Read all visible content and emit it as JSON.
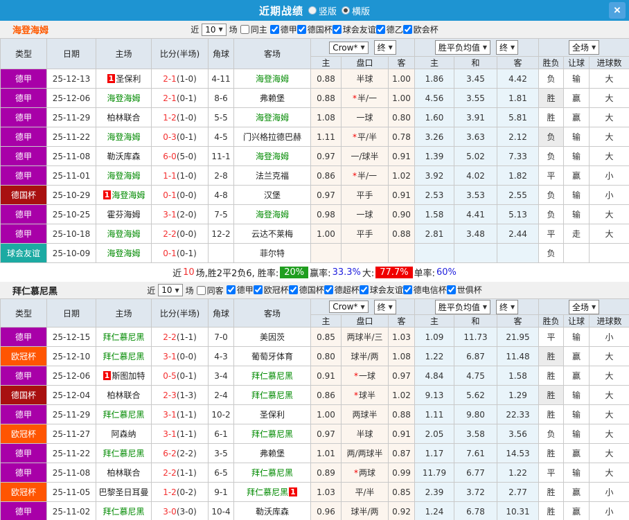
{
  "titlebar": {
    "title": "近期战绩",
    "vertical": "竖版",
    "horizontal": "横版",
    "selected": "横版",
    "close": "×"
  },
  "table_headers": {
    "type": "类型",
    "date": "日期",
    "home": "主场",
    "score": "比分(半场)",
    "corner": "角球",
    "away": "客场",
    "dd_company": "Crow*",
    "dd_final1": "终",
    "dd_avg": "胜平负均值",
    "dd_final2": "终",
    "dd_full": "全场",
    "sub_home": "主",
    "sub_handicap": "盘口",
    "sub_away": "客",
    "sub_avg_home": "主",
    "sub_avg_draw": "和",
    "sub_avg_away": "客",
    "sub_wdl": "胜负",
    "sub_let": "让球",
    "sub_goals": "进球数"
  },
  "type_colors": {
    "德甲": "#a800a8",
    "德国杯": "#a81010",
    "球会友谊": "#1caaa2",
    "欧冠杯": "#ff5502"
  },
  "result_colors": {
    "胜": "red",
    "负": "green",
    "平": "blue",
    "赢": "red",
    "输": "green",
    "走": "blue",
    "大": "red",
    "小": "green"
  },
  "sections": [
    {
      "team": "海登海姆",
      "team_color": "#ff5a00",
      "filter": {
        "prefix": "近",
        "count": "10",
        "suffix": "场",
        "same_label": "同主",
        "same_checked": false,
        "leagues": [
          "德甲",
          "德国杯",
          "球会友谊",
          "德乙",
          "欧会杯"
        ]
      },
      "rows": [
        {
          "type": "德甲",
          "date": "25-12-13",
          "home": "圣保利",
          "home_self": false,
          "home_badge": "1",
          "away": "海登海姆",
          "away_self": true,
          "away_badge": null,
          "score": "2-1",
          "half": "(1-0)",
          "corner": "4-11",
          "crown": [
            "0.88",
            "半球",
            "1.00"
          ],
          "star": false,
          "avg": [
            "1.86",
            "3.45",
            "4.42"
          ],
          "res": [
            "负",
            "输",
            "大"
          ],
          "res_gray": false
        },
        {
          "type": "德甲",
          "date": "25-12-06",
          "home": "海登海姆",
          "home_self": true,
          "home_badge": null,
          "away": "弗赖堡",
          "away_self": false,
          "away_badge": null,
          "score": "2-1",
          "half": "(0-1)",
          "corner": "8-6",
          "crown": [
            "0.88",
            "半/一",
            "1.00"
          ],
          "star": true,
          "avg": [
            "4.56",
            "3.55",
            "1.81"
          ],
          "res": [
            "胜",
            "赢",
            "大"
          ],
          "res_gray": true
        },
        {
          "type": "德甲",
          "date": "25-11-29",
          "home": "柏林联合",
          "home_self": false,
          "home_badge": null,
          "away": "海登海姆",
          "away_self": true,
          "away_badge": null,
          "score": "1-2",
          "half": "(1-0)",
          "corner": "5-5",
          "crown": [
            "1.08",
            "一球",
            "0.80"
          ],
          "star": false,
          "avg": [
            "1.60",
            "3.91",
            "5.81"
          ],
          "res": [
            "胜",
            "赢",
            "大"
          ],
          "res_gray": false
        },
        {
          "type": "德甲",
          "date": "25-11-22",
          "home": "海登海姆",
          "home_self": true,
          "home_badge": null,
          "away": "门兴格拉德巴赫",
          "away_self": false,
          "away_badge": null,
          "score": "0-3",
          "half": "(0-1)",
          "corner": "4-5",
          "crown": [
            "1.11",
            "平/半",
            "0.78"
          ],
          "star": true,
          "avg": [
            "3.26",
            "3.63",
            "2.12"
          ],
          "res": [
            "负",
            "输",
            "大"
          ],
          "res_gray": true
        },
        {
          "type": "德甲",
          "date": "25-11-08",
          "home": "勒沃库森",
          "home_self": false,
          "home_badge": null,
          "away": "海登海姆",
          "away_self": true,
          "away_badge": null,
          "score": "6-0",
          "half": "(5-0)",
          "corner": "11-1",
          "crown": [
            "0.97",
            "一/球半",
            "0.91"
          ],
          "star": false,
          "avg": [
            "1.39",
            "5.02",
            "7.33"
          ],
          "res": [
            "负",
            "输",
            "大"
          ],
          "res_gray": false
        },
        {
          "type": "德甲",
          "date": "25-11-01",
          "home": "海登海姆",
          "home_self": true,
          "home_badge": null,
          "away": "法兰克福",
          "away_self": false,
          "away_badge": null,
          "score": "1-1",
          "half": "(1-0)",
          "corner": "2-8",
          "crown": [
            "0.86",
            "半/一",
            "1.02"
          ],
          "star": true,
          "avg": [
            "3.92",
            "4.02",
            "1.82"
          ],
          "res": [
            "平",
            "赢",
            "小"
          ],
          "res_gray": false
        },
        {
          "type": "德国杯",
          "date": "25-10-29",
          "home": "海登海姆",
          "home_self": true,
          "home_badge": "1",
          "away": "汉堡",
          "away_self": false,
          "away_badge": null,
          "score": "0-1",
          "half": "(0-0)",
          "corner": "4-8",
          "crown": [
            "0.97",
            "平手",
            "0.91"
          ],
          "star": false,
          "avg": [
            "2.53",
            "3.53",
            "2.55"
          ],
          "res": [
            "负",
            "输",
            "小"
          ],
          "res_gray": false
        },
        {
          "type": "德甲",
          "date": "25-10-25",
          "home": "霍芬海姆",
          "home_self": false,
          "home_badge": null,
          "away": "海登海姆",
          "away_self": true,
          "away_badge": null,
          "score": "3-1",
          "half": "(2-0)",
          "corner": "7-5",
          "crown": [
            "0.98",
            "一球",
            "0.90"
          ],
          "star": false,
          "avg": [
            "1.58",
            "4.41",
            "5.13"
          ],
          "res": [
            "负",
            "输",
            "大"
          ],
          "res_gray": false
        },
        {
          "type": "德甲",
          "date": "25-10-18",
          "home": "海登海姆",
          "home_self": true,
          "home_badge": null,
          "away": "云达不莱梅",
          "away_self": false,
          "away_badge": null,
          "score": "2-2",
          "half": "(0-0)",
          "corner": "12-2",
          "crown": [
            "1.00",
            "平手",
            "0.88"
          ],
          "star": false,
          "avg": [
            "2.81",
            "3.48",
            "2.44"
          ],
          "res": [
            "平",
            "走",
            "大"
          ],
          "res_gray": false
        },
        {
          "type": "球会友谊",
          "date": "25-10-09",
          "home": "海登海姆",
          "home_self": true,
          "home_badge": null,
          "away": "菲尔特",
          "away_self": false,
          "away_badge": null,
          "score": "0-1",
          "half": "(0-1)",
          "corner": "",
          "crown": [
            "",
            "",
            ""
          ],
          "star": false,
          "avg": [
            "",
            "",
            ""
          ],
          "res": [
            "负",
            "",
            ""
          ],
          "res_gray": false
        }
      ],
      "summary": [
        {
          "text": "近",
          "style": "plain"
        },
        {
          "text": "10",
          "style": "red"
        },
        {
          "text": "场,胜2平2负6, 胜率:",
          "style": "plain"
        },
        {
          "text": "20%",
          "style": "green-badge"
        },
        {
          "text": "赢率:",
          "style": "plain"
        },
        {
          "text": "33.3%",
          "style": "blue"
        },
        {
          "text": "大:",
          "style": "plain"
        },
        {
          "text": "77.7%",
          "style": "red-badge"
        },
        {
          "text": "单率:",
          "style": "plain"
        },
        {
          "text": "60%",
          "style": "blue"
        }
      ]
    },
    {
      "team": "拜仁慕尼黑",
      "team_color": "#222222",
      "filter": {
        "prefix": "近",
        "count": "10",
        "suffix": "场",
        "same_label": "同客",
        "same_checked": false,
        "leagues": [
          "德甲",
          "欧冠杯",
          "德国杯",
          "德超杯",
          "球会友谊",
          "德电信杯",
          "世俱杯"
        ]
      },
      "rows": [
        {
          "type": "德甲",
          "date": "25-12-15",
          "home": "拜仁慕尼黑",
          "home_self": true,
          "home_badge": null,
          "away": "美因茨",
          "away_self": false,
          "away_badge": null,
          "score": "2-2",
          "half": "(1-1)",
          "corner": "7-0",
          "crown": [
            "0.85",
            "两球半/三",
            "1.03"
          ],
          "star": false,
          "avg": [
            "1.09",
            "11.73",
            "21.95"
          ],
          "res": [
            "平",
            "输",
            "小"
          ],
          "res_gray": false
        },
        {
          "type": "欧冠杯",
          "date": "25-12-10",
          "home": "拜仁慕尼黑",
          "home_self": true,
          "home_badge": null,
          "away": "葡萄牙体育",
          "away_self": false,
          "away_badge": null,
          "score": "3-1",
          "half": "(0-0)",
          "corner": "4-3",
          "crown": [
            "0.80",
            "球半/两",
            "1.08"
          ],
          "star": false,
          "avg": [
            "1.22",
            "6.87",
            "11.48"
          ],
          "res": [
            "胜",
            "赢",
            "大"
          ],
          "res_gray": true
        },
        {
          "type": "德甲",
          "date": "25-12-06",
          "home": "斯图加特",
          "home_self": false,
          "home_badge": "1",
          "away": "拜仁慕尼黑",
          "away_self": true,
          "away_badge": null,
          "score": "0-5",
          "half": "(0-1)",
          "corner": "3-4",
          "crown": [
            "0.91",
            "一球",
            "0.97"
          ],
          "star": true,
          "avg": [
            "4.84",
            "4.75",
            "1.58"
          ],
          "res": [
            "胜",
            "赢",
            "大"
          ],
          "res_gray": false
        },
        {
          "type": "德国杯",
          "date": "25-12-04",
          "home": "柏林联合",
          "home_self": false,
          "home_badge": null,
          "away": "拜仁慕尼黑",
          "away_self": true,
          "away_badge": null,
          "score": "2-3",
          "half": "(1-3)",
          "corner": "2-4",
          "crown": [
            "0.86",
            "球半",
            "1.02"
          ],
          "star": true,
          "avg": [
            "9.13",
            "5.62",
            "1.29"
          ],
          "res": [
            "胜",
            "输",
            "大"
          ],
          "res_gray": true
        },
        {
          "type": "德甲",
          "date": "25-11-29",
          "home": "拜仁慕尼黑",
          "home_self": true,
          "home_badge": null,
          "away": "圣保利",
          "away_self": false,
          "away_badge": null,
          "score": "3-1",
          "half": "(1-1)",
          "corner": "10-2",
          "crown": [
            "1.00",
            "两球半",
            "0.88"
          ],
          "star": false,
          "avg": [
            "1.11",
            "9.80",
            "22.33"
          ],
          "res": [
            "胜",
            "输",
            "大"
          ],
          "res_gray": false
        },
        {
          "type": "欧冠杯",
          "date": "25-11-27",
          "home": "阿森纳",
          "home_self": false,
          "home_badge": null,
          "away": "拜仁慕尼黑",
          "away_self": true,
          "away_badge": null,
          "score": "3-1",
          "half": "(1-1)",
          "corner": "6-1",
          "crown": [
            "0.97",
            "半球",
            "0.91"
          ],
          "star": false,
          "avg": [
            "2.05",
            "3.58",
            "3.56"
          ],
          "res": [
            "负",
            "输",
            "大"
          ],
          "res_gray": false
        },
        {
          "type": "德甲",
          "date": "25-11-22",
          "home": "拜仁慕尼黑",
          "home_self": true,
          "home_badge": null,
          "away": "弗赖堡",
          "away_self": false,
          "away_badge": null,
          "score": "6-2",
          "half": "(2-2)",
          "corner": "3-5",
          "crown": [
            "1.01",
            "两/两球半",
            "0.87"
          ],
          "star": false,
          "avg": [
            "1.17",
            "7.61",
            "14.53"
          ],
          "res": [
            "胜",
            "赢",
            "大"
          ],
          "res_gray": false
        },
        {
          "type": "德甲",
          "date": "25-11-08",
          "home": "柏林联合",
          "home_self": false,
          "home_badge": null,
          "away": "拜仁慕尼黑",
          "away_self": true,
          "away_badge": null,
          "score": "2-2",
          "half": "(1-1)",
          "corner": "6-5",
          "crown": [
            "0.89",
            "两球",
            "0.99"
          ],
          "star": true,
          "avg": [
            "11.79",
            "6.77",
            "1.22"
          ],
          "res": [
            "平",
            "输",
            "大"
          ],
          "res_gray": false
        },
        {
          "type": "欧冠杯",
          "date": "25-11-05",
          "home": "巴黎圣日耳曼",
          "home_self": false,
          "home_badge": null,
          "away": "拜仁慕尼黑",
          "away_self": true,
          "away_badge": "1",
          "score": "1-2",
          "half": "(0-2)",
          "corner": "9-1",
          "crown": [
            "1.03",
            "平/半",
            "0.85"
          ],
          "star": false,
          "avg": [
            "2.39",
            "3.72",
            "2.77"
          ],
          "res": [
            "胜",
            "赢",
            "小"
          ],
          "res_gray": false
        },
        {
          "type": "德甲",
          "date": "25-11-02",
          "home": "拜仁慕尼黑",
          "home_self": true,
          "home_badge": null,
          "away": "勒沃库森",
          "away_self": false,
          "away_badge": null,
          "score": "3-0",
          "half": "(3-0)",
          "corner": "10-4",
          "crown": [
            "0.96",
            "球半/两",
            "0.92"
          ],
          "star": false,
          "avg": [
            "1.24",
            "6.78",
            "10.31"
          ],
          "res": [
            "胜",
            "赢",
            "小"
          ],
          "res_gray": false
        }
      ],
      "summary": null
    }
  ]
}
